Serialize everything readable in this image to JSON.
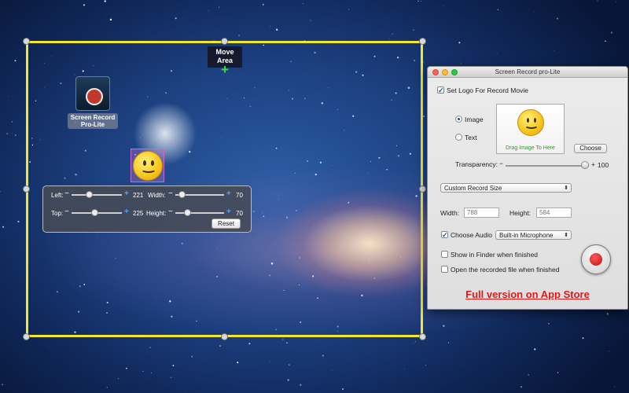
{
  "desktop": {
    "icon_label": "Screen Record Pro-Lite",
    "move_area_label": "Move Area",
    "move_icon": "plus-move-icon"
  },
  "position_panel": {
    "left_label": "Left:",
    "left_value": "221",
    "top_label": "Top:",
    "top_value": "225",
    "width_label": "Width:",
    "width_value": "70",
    "height_label": "Height:",
    "height_value": "70",
    "reset_label": "Reset",
    "minus": "−",
    "plus": "+"
  },
  "window": {
    "title": "Screen Record pro-Lite",
    "set_logo_label": "Set Logo For Record Movie",
    "image_label": "Image",
    "text_label": "Text",
    "drag_hint": "Drag Image To Here",
    "choose_label": "Choose",
    "transparency_label": "Transparency:",
    "transparency_minus": "−",
    "transparency_plus": "+",
    "transparency_value": "100",
    "record_size_select": "Custom Record Size",
    "width_label": "Width:",
    "width_placeholder": "788",
    "height_label": "Height:",
    "height_placeholder": "584",
    "choose_audio_label": "Choose Audio",
    "audio_select": "Built-in Microphone",
    "show_in_finder_label": "Show in Finder when finished",
    "open_file_label": "Open the recorded file when finished",
    "full_version_link": "Full version on App Store",
    "checkmark": "✓",
    "select_arrows": "⬍"
  },
  "colors": {
    "selection_border": "#f2e82a",
    "link_red": "#e21a1a",
    "record_red": "#c20e0e",
    "close": "#ff5f57",
    "minimize": "#febc2e",
    "zoom": "#28c840"
  }
}
